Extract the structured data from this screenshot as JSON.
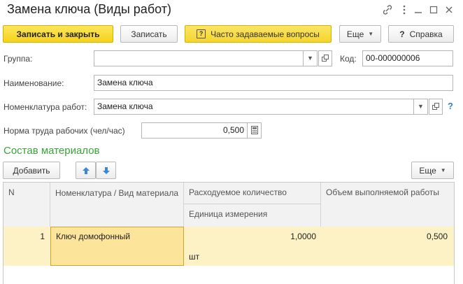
{
  "window": {
    "title": "Замена ключа (Виды работ)",
    "icons": [
      "link-icon",
      "more-icon",
      "minimize-icon",
      "maximize-icon",
      "close-icon"
    ]
  },
  "toolbar": {
    "save_close": "Записать и закрыть",
    "save": "Записать",
    "faq": "Часто задаваемые вопросы",
    "more": "Еще",
    "help": "Справка"
  },
  "form": {
    "group_label": "Группа:",
    "group_value": "",
    "code_label": "Код:",
    "code_value": "00-000000006",
    "name_label": "Наименование:",
    "name_value": "Замена ключа",
    "nomenclature_label": "Номенклатура работ:",
    "nomenclature_value": "Замена ключа",
    "norm_label": "Норма труда рабочих (чел/час)",
    "norm_value": "0,500"
  },
  "materials": {
    "section_title": "Состав материалов",
    "add_label": "Добавить",
    "more_label": "Еще",
    "columns": {
      "n": "N",
      "nomenclature": "Номенклатура / Вид материала",
      "quantity": "Расходуемое количество",
      "unit": "Единица измерения",
      "volume": "Объем выполняемой работы"
    },
    "rows": [
      {
        "n": "1",
        "nomenclature": "Ключ домофонный",
        "quantity": "1,0000",
        "unit": "шт",
        "volume": "0,500"
      }
    ]
  },
  "colors": {
    "accent_yellow": "#f6d21a",
    "section_green": "#3aa33a",
    "row_highlight": "#fdf2c6",
    "selected_cell": "#fce59a"
  }
}
